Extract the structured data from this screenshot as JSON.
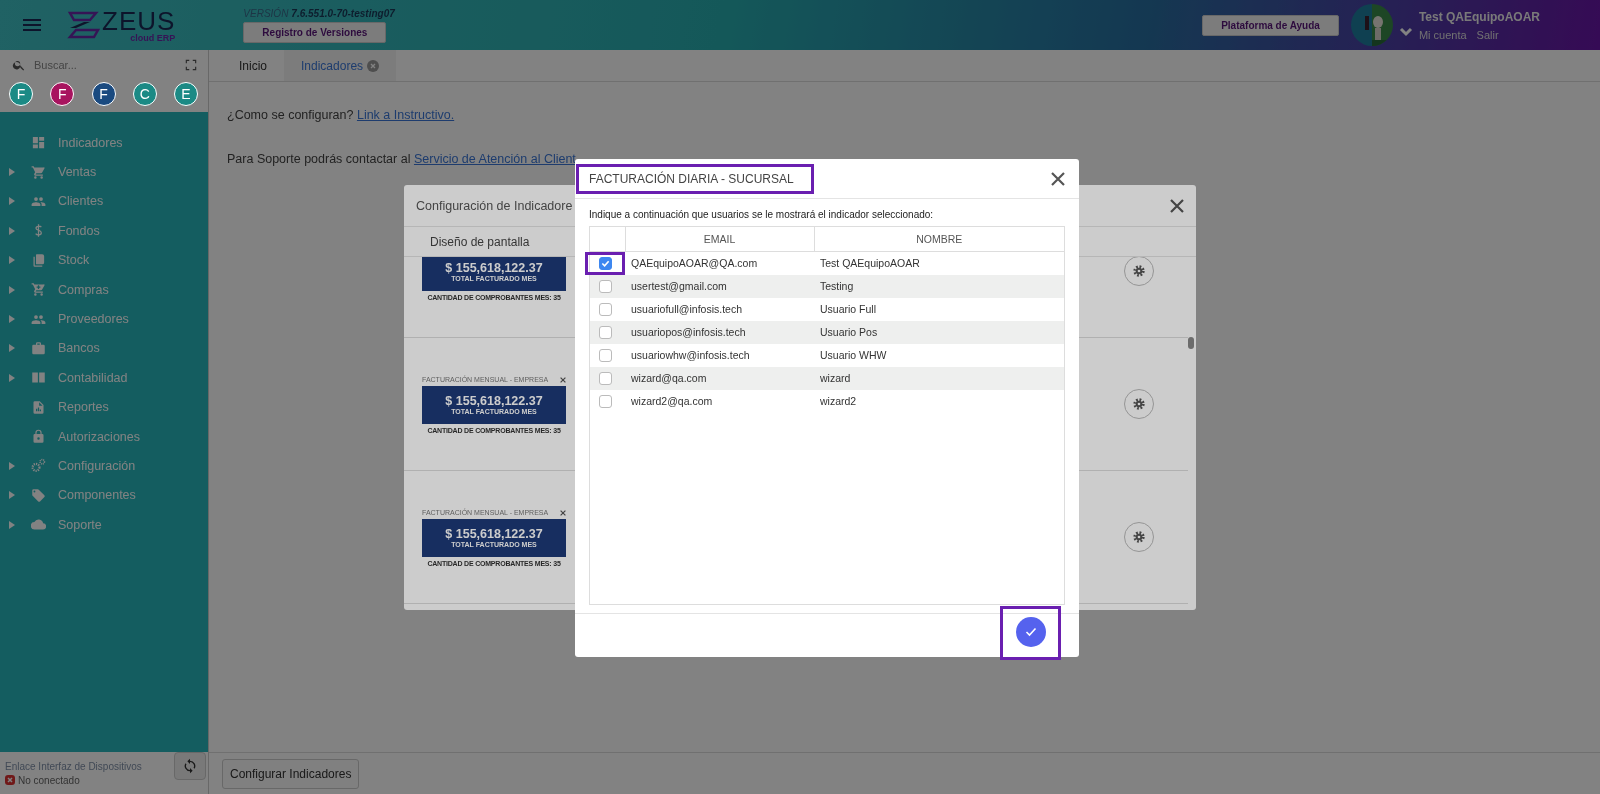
{
  "header": {
    "logo_text": "ZEUS",
    "logo_sub": "cloud ERP",
    "version_label": "VERSIÓN",
    "version": "7.6.551.0-70-testing07",
    "versions_button": "Registro de Versiones",
    "help_button": "Plataforma de Ayuda",
    "user_name": "Test QAEquipoAOAR",
    "account_link": "Mi cuenta",
    "logout_link": "Salir"
  },
  "sidebar": {
    "search_placeholder": "Buscar...",
    "shortcuts": [
      {
        "letter": "F",
        "color": "#1b8a85"
      },
      {
        "letter": "F",
        "color": "#a8145f"
      },
      {
        "letter": "F",
        "color": "#1a4a80"
      },
      {
        "letter": "C",
        "color": "#1b8a85"
      },
      {
        "letter": "E",
        "color": "#1b8a85"
      }
    ],
    "items": [
      {
        "label": "Indicadores",
        "expandable": false
      },
      {
        "label": "Ventas",
        "expandable": true
      },
      {
        "label": "Clientes",
        "expandable": true
      },
      {
        "label": "Fondos",
        "expandable": true
      },
      {
        "label": "Stock",
        "expandable": true
      },
      {
        "label": "Compras",
        "expandable": true
      },
      {
        "label": "Proveedores",
        "expandable": true
      },
      {
        "label": "Bancos",
        "expandable": true
      },
      {
        "label": "Contabilidad",
        "expandable": true
      },
      {
        "label": "Reportes",
        "expandable": false
      },
      {
        "label": "Autorizaciones",
        "expandable": false
      },
      {
        "label": "Configuración",
        "expandable": true
      },
      {
        "label": "Componentes",
        "expandable": true
      },
      {
        "label": "Soporte",
        "expandable": true
      }
    ],
    "device_link": {
      "title": "Enlace Interfaz de Dispositivos",
      "status": "No conectado"
    }
  },
  "tabs": [
    {
      "label": "Inicio",
      "selected": false,
      "closable": false
    },
    {
      "label": "Indicadores",
      "selected": true,
      "closable": true
    }
  ],
  "content": {
    "help_text": "¿Como se configuran?",
    "help_link": "Link a Instructivo.",
    "support_text": "Para Soporte podrás contactar al",
    "support_link": "Servicio de Atención al Client"
  },
  "config_dialog": {
    "title": "Configuración de Indicadore",
    "tabs": [
      {
        "label": "Diseño de pantalla",
        "selected": false
      }
    ],
    "indicators": [
      {
        "amount": "$ 155,618,122.37",
        "subtitle": "TOTAL FACTURADO MES",
        "footer": "CANTIDAD DE COMPROBANTES MES: 35"
      },
      {
        "title": "FACTURACIÓN MENSUAL - EMPRESA",
        "amount": "$ 155,618,122.37",
        "subtitle": "TOTAL FACTURADO MES",
        "footer": "CANTIDAD DE COMPROBANTES MES: 35"
      },
      {
        "title": "FACTURACIÓN MENSUAL - EMPRESA",
        "amount": "$ 155,618,122.37",
        "subtitle": "TOTAL FACTURADO MES",
        "footer": "CANTIDAD DE COMPROBANTES MES: 35"
      }
    ]
  },
  "users_dialog": {
    "title": "FACTURACIÓN DIARIA - SUCURSAL",
    "title_highlighted": true,
    "instruction": "Indique a continuación que usuarios se le mostrará el indicador seleccionado:",
    "columns": [
      "EMAIL",
      "NOMBRE"
    ],
    "rows": [
      {
        "email": "QAEquipoAOAR@QA.com",
        "name": "Test QAEquipoAOAR",
        "checked": true,
        "highlighted": true
      },
      {
        "email": "usertest@gmail.com",
        "name": "Testing",
        "checked": false,
        "highlighted": false
      },
      {
        "email": "usuariofull@infosis.tech",
        "name": "Usuario Full",
        "checked": false,
        "highlighted": false
      },
      {
        "email": "usuariopos@infosis.tech",
        "name": "Usuario Pos",
        "checked": false,
        "highlighted": false
      },
      {
        "email": "usuariowhw@infosis.tech",
        "name": "Usuario WHW",
        "checked": false,
        "highlighted": false
      },
      {
        "email": "wizard@qa.com",
        "name": "wizard",
        "checked": false,
        "highlighted": false
      },
      {
        "email": "wizard2@qa.com",
        "name": "wizard2",
        "checked": false,
        "highlighted": false
      }
    ],
    "confirm_highlighted": true
  },
  "bottom_bar": {
    "configure_button": "Configurar Indicadores"
  }
}
